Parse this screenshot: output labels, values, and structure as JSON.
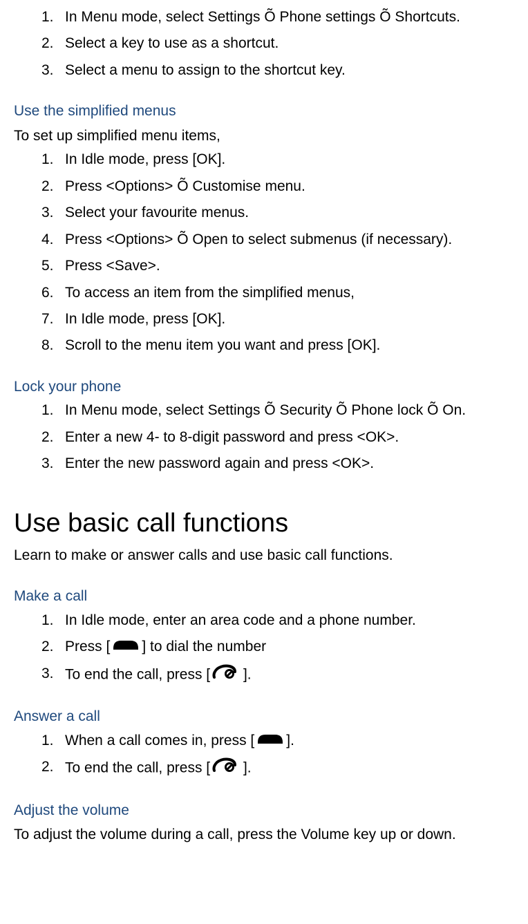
{
  "list1": {
    "items": [
      "In Menu mode, select Settings Õ Phone settings Õ Shortcuts.",
      "Select a key to use as a shortcut.",
      "Select a menu to assign to the shortcut key."
    ]
  },
  "section_simplified": {
    "title": "Use the simplified menus",
    "intro": "To set up simplified menu items,",
    "items": [
      "In Idle mode, press [OK].",
      "Press <Options> Õ Customise menu.",
      "Select your favourite menus.",
      "Press <Options> Õ Open to select submenus (if necessary).",
      "Press <Save>.",
      "To access an item from the simplified menus,",
      "In Idle mode, press [OK].",
      "Scroll to the menu item you want and press [OK]."
    ]
  },
  "section_lock": {
    "title": "Lock your phone",
    "items": [
      "In Menu mode, select Settings Õ Security Õ Phone lock Õ On.",
      "Enter a new 4- to 8-digit password and press <OK>.",
      "Enter the new password again and press <OK>."
    ]
  },
  "main_heading": "Use basic call functions",
  "main_intro": "Learn to make or answer calls and use basic call functions.",
  "section_make_call": {
    "title": "Make a call",
    "item1": "In Idle mode, enter an area code and a phone number.",
    "item2_pre": "Press [",
    "item2_post": "] to dial the number",
    "item3_pre": "To end the call, press [",
    "item3_post": " ]."
  },
  "section_answer_call": {
    "title": "Answer a call",
    "item1_pre": "When a call comes in, press [",
    "item1_post": "].",
    "item2_pre": "To end the call, press [",
    "item2_post": " ]."
  },
  "section_volume": {
    "title": "Adjust the volume",
    "intro": "To adjust the volume during a call, press the Volume key up or down."
  }
}
